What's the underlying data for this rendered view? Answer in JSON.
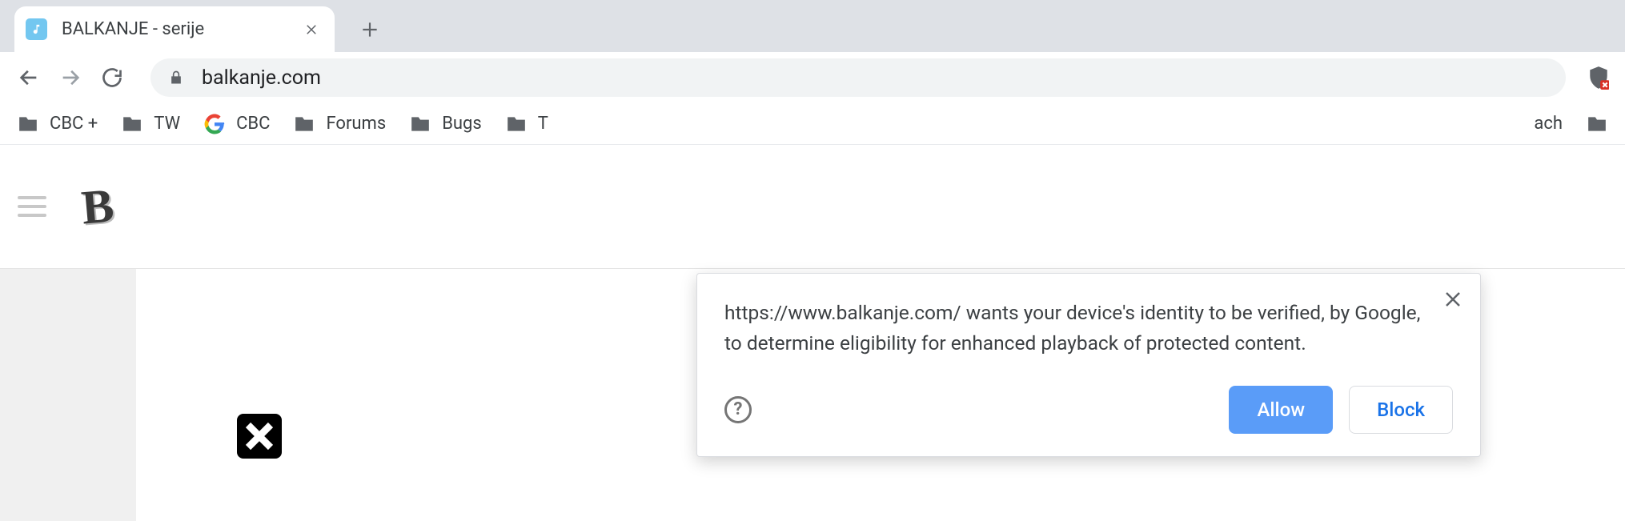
{
  "tab": {
    "title": "BALKANJE - serije"
  },
  "omnibox": {
    "domain": "balkanje.com"
  },
  "bookmarks": [
    {
      "label": "CBC +",
      "type": "folder"
    },
    {
      "label": "TW",
      "type": "folder"
    },
    {
      "label": "CBC",
      "type": "google"
    },
    {
      "label": "Forums",
      "type": "folder"
    },
    {
      "label": "Bugs",
      "type": "folder"
    },
    {
      "label": "T",
      "type": "folder"
    }
  ],
  "bookmark_tail": {
    "label": "ach"
  },
  "site": {
    "logo_letter": "B"
  },
  "dialog": {
    "message": "https://www.balkanje.com/ wants your device's identity to be verified, by Google, to determine eligibility for enhanced playback of protected content.",
    "help_glyph": "?",
    "allow_label": "Allow",
    "block_label": "Block"
  }
}
